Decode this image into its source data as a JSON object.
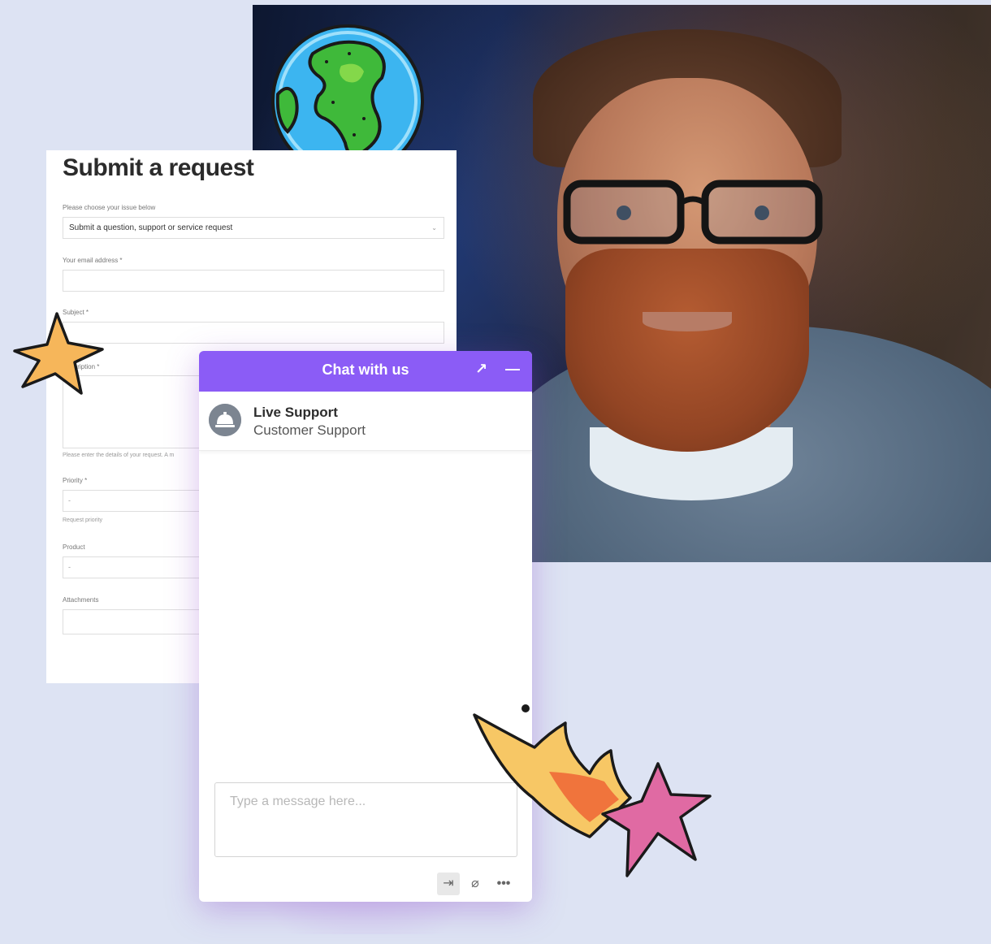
{
  "request_form": {
    "title": "Submit a request",
    "issue_label": "Please choose your issue below",
    "issue_value": "Submit a question, support or service request",
    "email_label": "Your email address *",
    "subject_label": "Subject *",
    "description_label": "Description *",
    "description_help": "Please enter the details of your request. A m",
    "priority_label": "Priority *",
    "priority_value": "-",
    "priority_help": "Request priority",
    "product_label": "Product",
    "product_value": "-",
    "attachments_label": "Attachments"
  },
  "chat": {
    "title": "Chat with us",
    "expand_glyph": "↗",
    "minimize_glyph": "—",
    "agent_name": "Live Support",
    "agent_role": "Customer Support",
    "message_placeholder": "Type a message here...",
    "tools": {
      "exit_glyph": "⇥",
      "attach_glyph": "⌀",
      "more_glyph": "•••"
    },
    "accent_color": "#8b5cf6"
  },
  "icons": [
    "globe-icon",
    "star-icon",
    "comet-icon",
    "concierge-bell-icon",
    "exit-icon",
    "paperclip-icon",
    "more-icon"
  ]
}
